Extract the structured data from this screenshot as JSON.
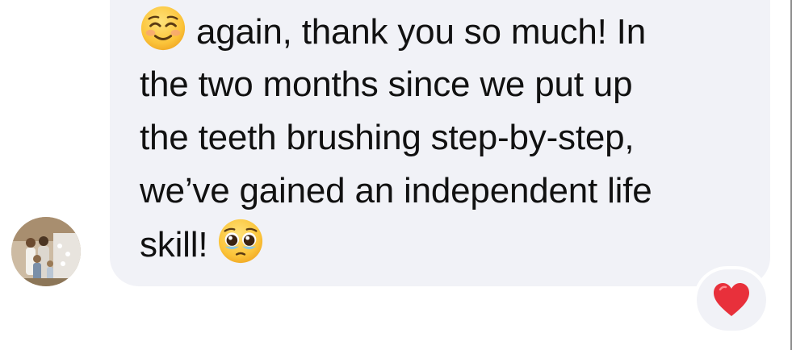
{
  "message": {
    "line1_text": "again, thank you so much! In",
    "line2_text": "the two months since we put up",
    "line3_text": "the teeth brushing step-by-step,",
    "line4_text": "we’ve gained an independent life",
    "line5_text": "skill!",
    "leading_emoji": "smiling-face-icon",
    "trailing_emoji": "pleading-face-icon"
  },
  "reaction": {
    "icon": "heart-icon",
    "color": "#e8303b"
  },
  "colors": {
    "bubble": "#f1f2f7",
    "text": "#111111"
  }
}
